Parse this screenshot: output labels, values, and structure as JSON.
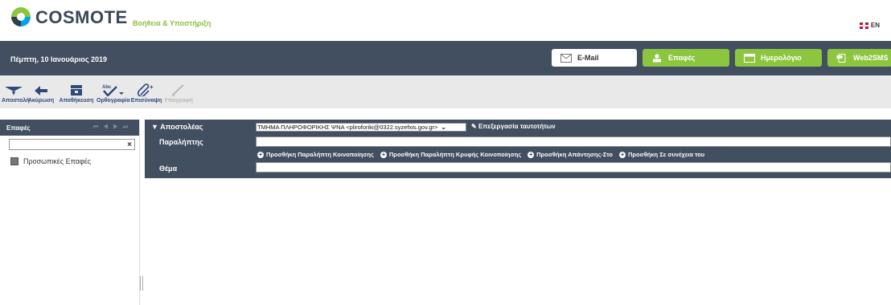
{
  "header": {
    "brand": "COSMOTE",
    "help_link": "Βοήθεια & Υποστήριξη",
    "language": "EN"
  },
  "topbar": {
    "date": "Πέμπτη, 10 Ιανουάριος 2019",
    "tabs": [
      {
        "label": "E-Mail",
        "icon": "envelope-icon"
      },
      {
        "label": "Επαφές",
        "icon": "person-icon"
      },
      {
        "label": "Ημερολόγιο",
        "icon": "calendar-icon"
      },
      {
        "label": "Web2SMS",
        "icon": "sms-icon"
      }
    ]
  },
  "toolbar": {
    "send": "Αποστολή",
    "cancel": "Ακύρωση",
    "save": "Αποθήκευση",
    "spelling": "Ορθογραφία",
    "attach": "Επισύναψη",
    "signature": "Υπογραφή"
  },
  "sidebar": {
    "title": "Επαφές",
    "search_value": "",
    "items": [
      {
        "label": "Προσωπικές Επαφές"
      }
    ]
  },
  "compose": {
    "from_label": "Αποστολέας",
    "from_value": "ΤΜΗΜΑ ΠΛΗΡΟΦΟΡΙΚΗΣ ΨΝΑ <pliroforiki@0322.syzefxis.gov.gr>",
    "edit_identities": "Επεξεργασία ταυτοτήτων",
    "to_label": "Παραλήπτης",
    "add_cc": "Προσθήκη Παραλήπτη Κοινοποίησης",
    "add_bcc": "Προσθήκη Παραλήπτη Κρυφής Κοινοποίησης",
    "add_reply_to": "Προσθήκη Απάντησης-Στο",
    "add_followup": "Προσθήκη Σε συνέχεια του",
    "subject_label": "Θέμα"
  },
  "colors": {
    "dark": "#414f61",
    "green": "#8cc63f",
    "toolbar_bg": "#e9e9e9"
  }
}
